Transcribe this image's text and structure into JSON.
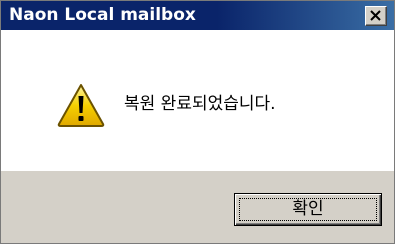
{
  "window": {
    "title": "Naon Local mailbox",
    "close_icon": "close-icon"
  },
  "message": {
    "icon": "warning-icon",
    "text": "복원 완료되었습니다."
  },
  "buttons": {
    "ok_label": "확인"
  },
  "colors": {
    "titlebar": "#0a246a",
    "dialog_face": "#d4d0c8",
    "warning_fill": "#f5c400"
  }
}
